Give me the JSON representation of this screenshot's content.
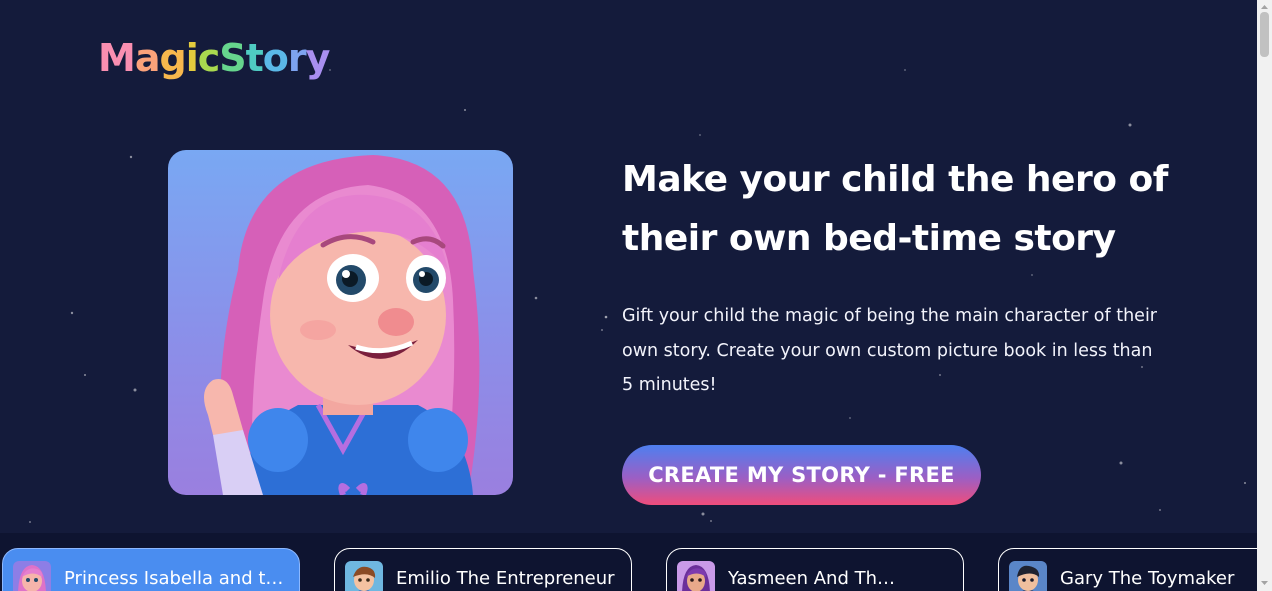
{
  "brand": {
    "letters": [
      "M",
      "a",
      "g",
      "i",
      "c",
      "S",
      "t",
      "o",
      "r",
      "y"
    ],
    "letter_colors": [
      "#f98fb1",
      "#fba27a",
      "#f8b84d",
      "#e3cb3d",
      "#a9d94f",
      "#66d58d",
      "#4fcbc2",
      "#5bb8e8",
      "#7da3ef",
      "#a98ff0"
    ]
  },
  "hero": {
    "headline": "Make your child the hero of their own bed-time story",
    "subtext": "Gift your child the magic of being the main character of their own story. Create your own custom picture book in less than 5 minutes!",
    "cta_label": "CREATE MY STORY - FREE",
    "illustration": "cartoon-girl-pink-hair"
  },
  "stories": [
    {
      "title": "Princess Isabella and the Magic Kingdom",
      "thumb": "pink-hair-girl",
      "active": true
    },
    {
      "title": "Emilio The Entrepreneur",
      "thumb": "brown-hair-boy",
      "active": false
    },
    {
      "title": "Yasmeen And The Enchanted Garden",
      "thumb": "purple-hair-girl",
      "active": false
    },
    {
      "title": "Gary The Toymaker",
      "thumb": "dark-hair-boy",
      "active": false
    }
  ],
  "colors": {
    "background": "#141b3b",
    "strip": "#0e1430",
    "active_card": "#4a8df0",
    "cta_top": "#4e7ff0",
    "cta_bottom": "#f04d7b"
  }
}
